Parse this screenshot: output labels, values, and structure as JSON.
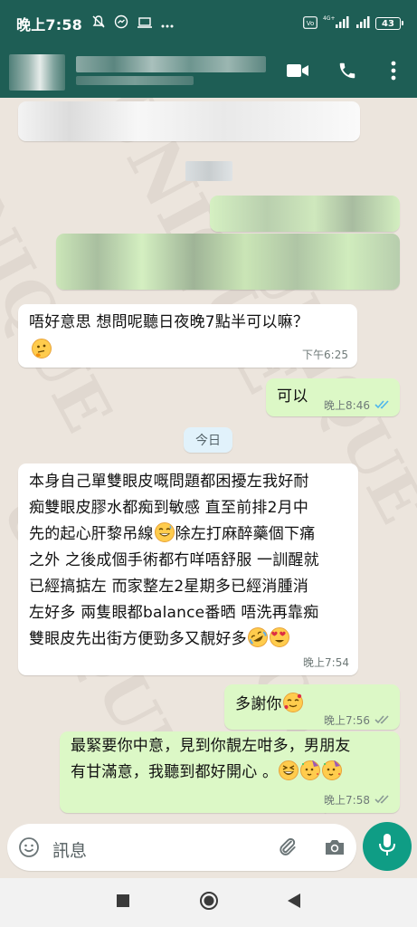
{
  "status_bar": {
    "time": "晚上7:58",
    "network": "4G+",
    "battery": "43"
  },
  "app_bar": {
    "icons": [
      "video-call-icon",
      "phone-icon",
      "more-vert-icon"
    ]
  },
  "chat": {
    "date_divider": "今日",
    "messages": [
      {
        "direction": "incoming",
        "text": "唔好意思 想問呢聽日夜晚7點半可以嘛？",
        "emojis": [
          "thinking-face"
        ],
        "time": "下午6:25"
      },
      {
        "direction": "outgoing",
        "text": "可以",
        "time": "晚上8:46",
        "status": "read"
      },
      {
        "direction": "incoming",
        "text_lines": [
          "本身自己單雙眼皮嘅問題都困擾左我好耐",
          "痴雙眼皮膠水都痴到敏感 直至前排2月中",
          "先的起心肝黎吊線",
          "除左打麻醉藥個下痛",
          "之外 之後成個手術都冇咩唔舒服 一訓醒就",
          "已經搞掂左 而家整左2星期多已經消腫消",
          "左好多 兩隻眼都balance番晒 唔洗再靠痴",
          "雙眼皮先出街方便勁多又靚好多"
        ],
        "emojis": [
          "grinning-sweat",
          "rolling-laughing",
          "heart-eyes"
        ],
        "time": "晚上7:54"
      },
      {
        "direction": "outgoing",
        "text": "多謝你",
        "emojis": [
          "smiling-hearts"
        ],
        "time": "晚上7:56",
        "status": "delivered"
      },
      {
        "direction": "outgoing",
        "text_lines": [
          "最緊要你中意，見到你靚左咁多，男朋友",
          "有甘滿意，我聽到都好開心 。"
        ],
        "emojis": [
          "grinning-squint",
          "partying-face",
          "partying-face"
        ],
        "time": "晚上7:58",
        "status": "delivered"
      }
    ]
  },
  "input": {
    "placeholder": "訊息"
  },
  "colors": {
    "header": "#1E5E55",
    "chat_background": "#ECE5DD",
    "incoming_bubble": "#FFFFFF",
    "outgoing_bubble": "#DCF8C6",
    "mic_button": "#0F9D85",
    "read_tick": "#4FB6EC"
  }
}
